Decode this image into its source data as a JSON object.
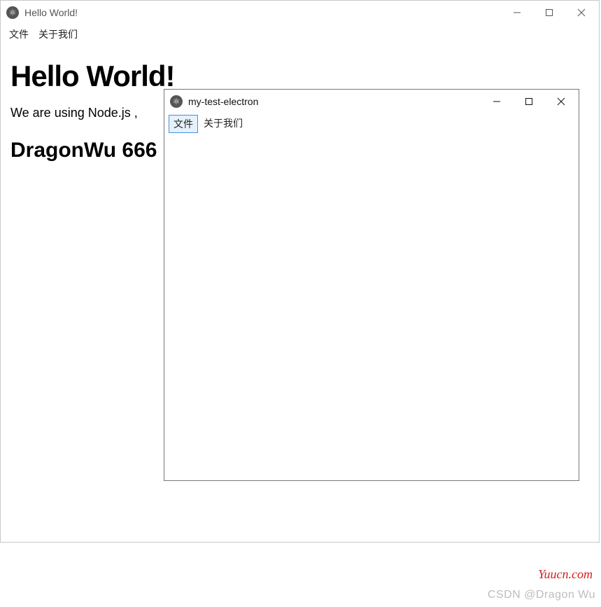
{
  "back": {
    "title": "Hello World!",
    "menu": {
      "file": "文件",
      "about": "关于我们"
    },
    "body": {
      "heading": "Hello World!",
      "paragraph": "We are using Node.js ,",
      "subheading": "DragonWu 666"
    }
  },
  "front": {
    "title": "my-test-electron",
    "menu": {
      "file": "文件",
      "about": "关于我们"
    }
  },
  "watermarks": {
    "red": "Yuucn.com",
    "grey": "CSDN @Dragon   Wu"
  }
}
